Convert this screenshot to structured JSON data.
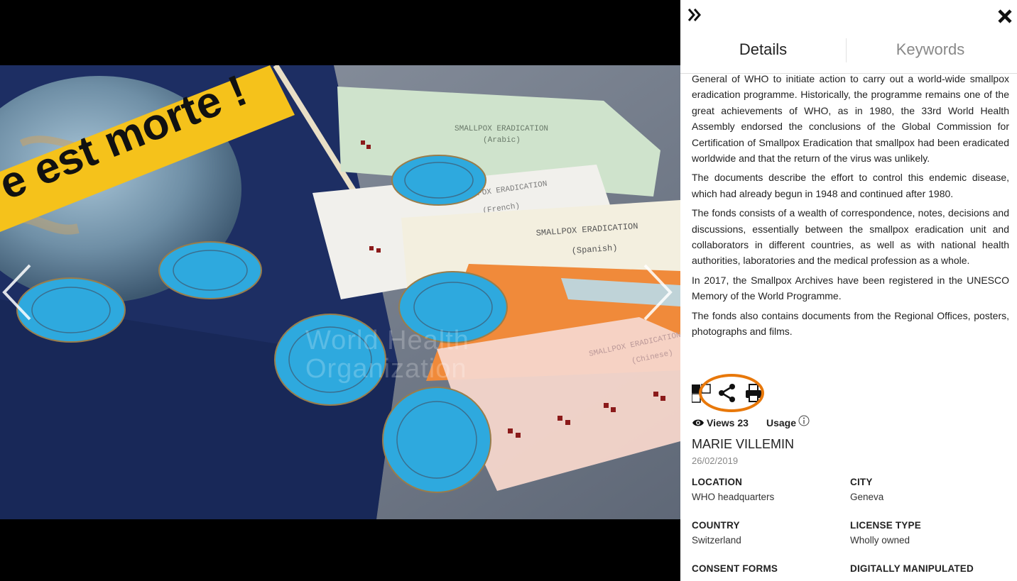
{
  "viewer": {
    "banner_text": "e est morte !",
    "watermark_line1": "World Health",
    "watermark_line2": "Organization",
    "envelopes": [
      {
        "title": "SMALLPOX ERADICATION",
        "sub": "(Arabic)",
        "color": "#cfe3cc"
      },
      {
        "title": "SMALLPOX ERADICATION",
        "sub": "(French)",
        "color": "#f1f0ec"
      },
      {
        "title": "SMALLPOX ERADICATION",
        "sub": "(Spanish)",
        "color": "#f3efdf"
      },
      {
        "title": "SMALLPOX ERADICATION",
        "sub": "(Chinese)",
        "color": "#f6d6cb"
      }
    ],
    "colors": {
      "backdrop": "#000000",
      "table": "#7b8494",
      "medal": "#2ea9de",
      "banner": "#f5c21b",
      "orange_envelope": "#f08a3a"
    }
  },
  "sidebar": {
    "tabs": {
      "details": "Details",
      "keywords": "Keywords"
    },
    "description": [
      "General of WHO to initiate action to carry out a world-wide smallpox eradication programme. Historically, the programme remains one of the great achievements of WHO, as in 1980, the 33rd World Health Assembly endorsed the conclusions of the Global Commission for Certification of Smallpox Eradication that smallpox had been eradicated worldwide and that the return of the virus was unlikely.",
      "The documents describe the effort to control this endemic disease, which had already begun in 1948 and continued after 1980.",
      "The fonds consists of a wealth of correspondence, notes, decisions and discussions, essentially between the smallpox eradication unit and collaborators in different countries, as well as with national health authorities, laboratories and the medical profession as a whole.",
      "In 2017, the Smallpox Archives have been registered in the UNESCO Memory of the World Programme.",
      "The fonds also contains documents from the Regional Offices, posters, photographs and films."
    ],
    "stats": {
      "views": "Views 23",
      "usage": "Usage"
    },
    "author": "MARIE VILLEMIN",
    "date": "26/02/2019",
    "fields": {
      "location": {
        "label": "LOCATION",
        "value": "WHO headquarters"
      },
      "city": {
        "label": "CITY",
        "value": "Geneva"
      },
      "country": {
        "label": "COUNTRY",
        "value": "Switzerland"
      },
      "license": {
        "label": "LICENSE TYPE",
        "value": "Wholly owned"
      },
      "consent": {
        "label": "CONSENT FORMS",
        "value": ""
      },
      "manipulated": {
        "label": "DIGITALLY MANIPULATED",
        "value": ""
      }
    },
    "highlight_color": "#e8780a"
  }
}
